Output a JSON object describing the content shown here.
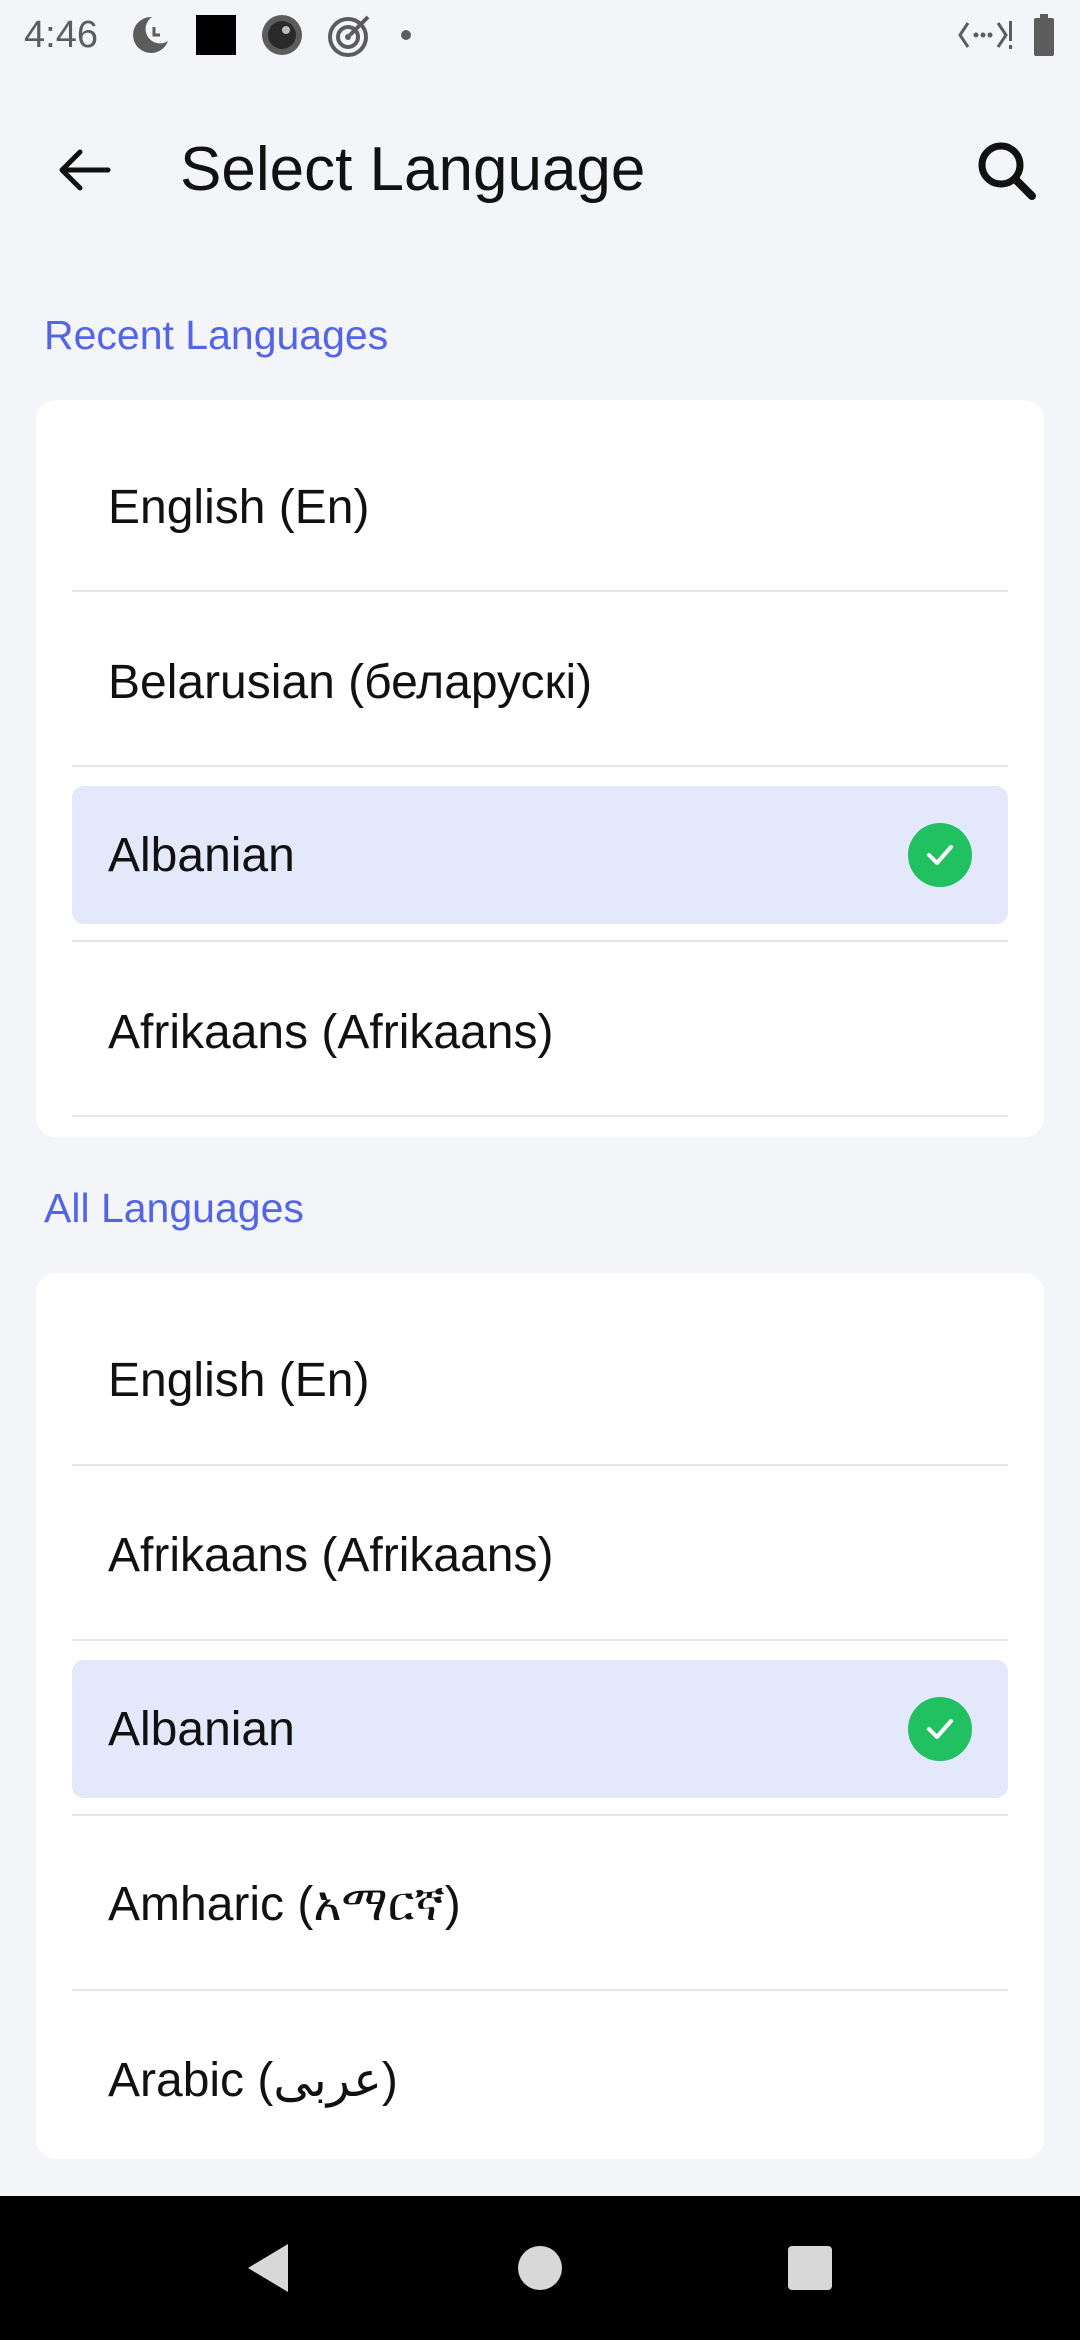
{
  "status_bar": {
    "time": "4:46",
    "icons_left": [
      "moon-clock-icon",
      "black-square-icon",
      "record-icon",
      "target-icon",
      "dot-icon"
    ],
    "icons_right": [
      "signal-code-icon",
      "battery-icon"
    ]
  },
  "app_bar": {
    "title": "Select Language",
    "back_icon": "arrow-left-icon",
    "search_icon": "search-icon"
  },
  "recent": {
    "title": "Recent Languages",
    "items": [
      {
        "label": "English (En)",
        "selected": false
      },
      {
        "label": "Belarusian (беларускі)",
        "selected": false
      },
      {
        "label": "Albanian",
        "selected": true
      },
      {
        "label": "Afrikaans (Afrikaans)",
        "selected": false
      }
    ]
  },
  "all": {
    "title": "All Languages",
    "items": [
      {
        "label": "English (En)",
        "selected": false
      },
      {
        "label": "Afrikaans (Afrikaans)",
        "selected": false
      },
      {
        "label": "Albanian",
        "selected": true
      },
      {
        "label": "Amharic (አማርኛ)",
        "selected": false
      },
      {
        "label": "Arabic (عربى)",
        "selected": false
      }
    ]
  },
  "nav_bar": {
    "icons": [
      "back-triangle-icon",
      "home-circle-icon",
      "recents-square-icon"
    ]
  },
  "colors": {
    "accent": "#5365e6",
    "selected_bg": "#e3e9fb",
    "check_green": "#21c061",
    "background": "#f4f5f9"
  }
}
